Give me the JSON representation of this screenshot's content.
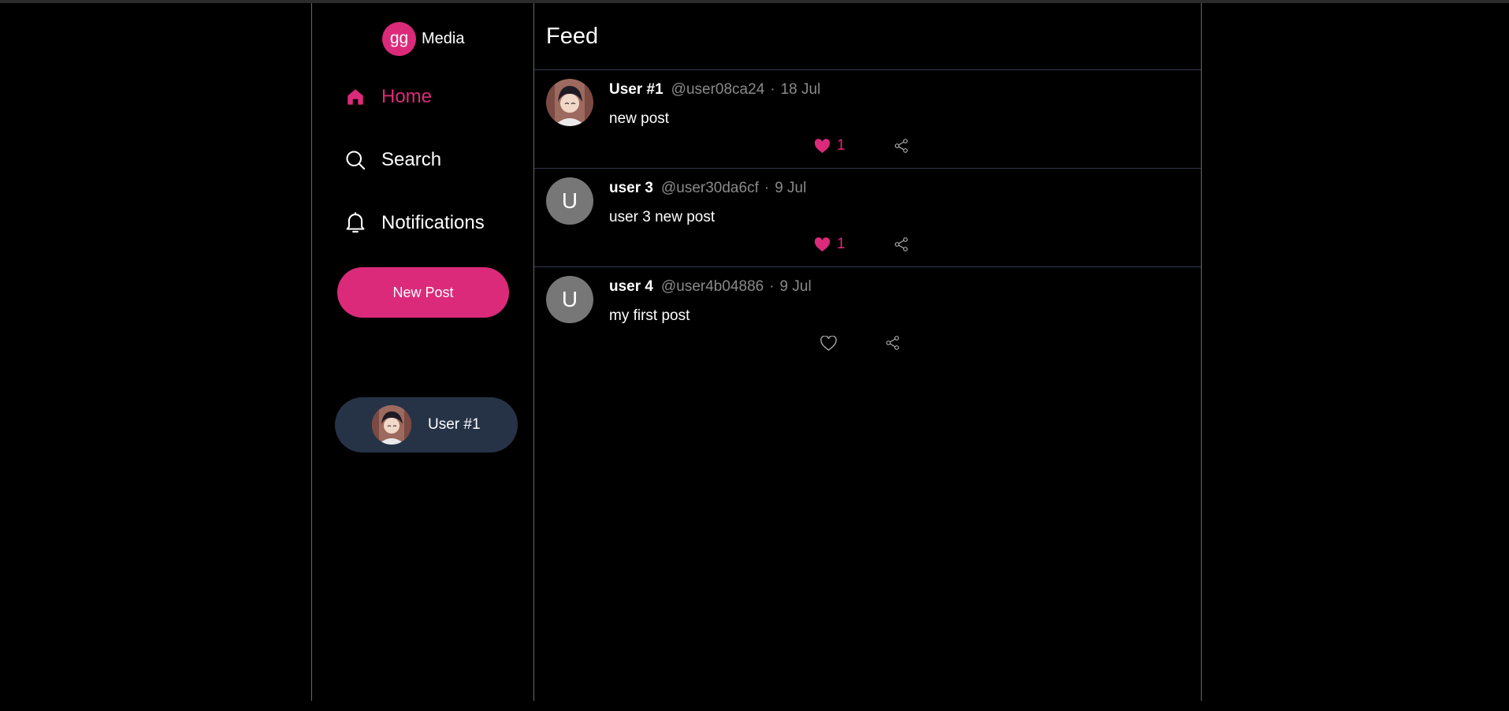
{
  "brand": {
    "logo_text": "gg",
    "name": "Media"
  },
  "colors": {
    "accent": "#dc2a7a",
    "pill_bg": "#263347",
    "avatar_placeholder": "#777777"
  },
  "nav": {
    "items": [
      {
        "label": "Home",
        "icon": "home-icon",
        "active": true
      },
      {
        "label": "Search",
        "icon": "search-icon",
        "active": false
      },
      {
        "label": "Notifications",
        "icon": "bell-icon",
        "active": false
      }
    ],
    "new_post_label": "New Post"
  },
  "profile": {
    "name": "User #1",
    "avatar": "anime-avatar"
  },
  "feed": {
    "title": "Feed",
    "posts": [
      {
        "name": "User #1",
        "handle": "@user08ca24",
        "date": "18 Jul",
        "content": "new post",
        "avatar": "anime-avatar",
        "liked": true,
        "likes": "1"
      },
      {
        "name": "user 3",
        "handle": "@user30da6cf",
        "date": "9 Jul",
        "content": "user 3 new post",
        "avatar_letter": "U",
        "liked": true,
        "likes": "1"
      },
      {
        "name": "user 4",
        "handle": "@user4b04886",
        "date": "9 Jul",
        "content": "my first post",
        "avatar_letter": "U",
        "liked": false,
        "likes": ""
      }
    ],
    "separator": "·"
  }
}
